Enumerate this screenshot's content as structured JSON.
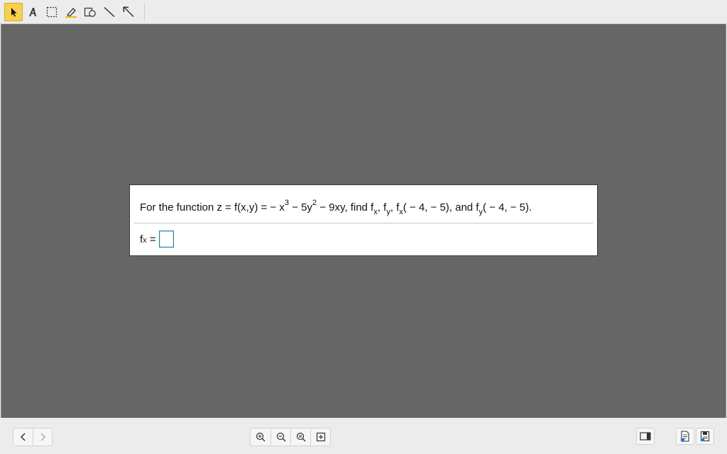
{
  "toolbar": {
    "tools": [
      {
        "name": "select-tool",
        "icon": "arrow-pointer-icon",
        "active": true
      },
      {
        "name": "text-tool",
        "icon": "text-a-icon"
      },
      {
        "name": "rectangle-select-tool",
        "icon": "dashed-rect-icon"
      },
      {
        "name": "highlighter-tool",
        "icon": "highlighter-icon"
      },
      {
        "name": "shape-tool",
        "icon": "shapes-icon"
      },
      {
        "name": "line-tool",
        "icon": "line-icon"
      },
      {
        "name": "arrow-tool",
        "icon": "arrow-up-left-icon"
      }
    ],
    "active_color": "#f7d04e"
  },
  "question": {
    "t1": "For the function z = f(x,y) =  − x",
    "e1": "3",
    "t2": " − 5y",
    "e2": "2",
    "t3": " − 9xy, find f",
    "s1": "x",
    "t4": ", f",
    "s2": "y",
    "t5": ", f",
    "s3": "x",
    "t6": "( − 4, − 5), and f",
    "s4": "y",
    "t7": "( − 4, − 5)."
  },
  "answer": {
    "base": "f",
    "sub": "x",
    "equals": " =",
    "value": ""
  },
  "bottombar": {
    "nav": [
      "chevron-left-icon",
      "chevron-right-icon"
    ],
    "zoom": [
      "zoom-in-icon",
      "zoom-out-icon",
      "zoom-reset-icon",
      "fit-page-icon"
    ],
    "right": [
      "sidebar-toggle-icon",
      "document-icon",
      "save-icon"
    ]
  },
  "colors": {
    "stage_bg": "#666666",
    "panel_bg": "#ffffff",
    "answer_border": "#2a7f9a"
  }
}
